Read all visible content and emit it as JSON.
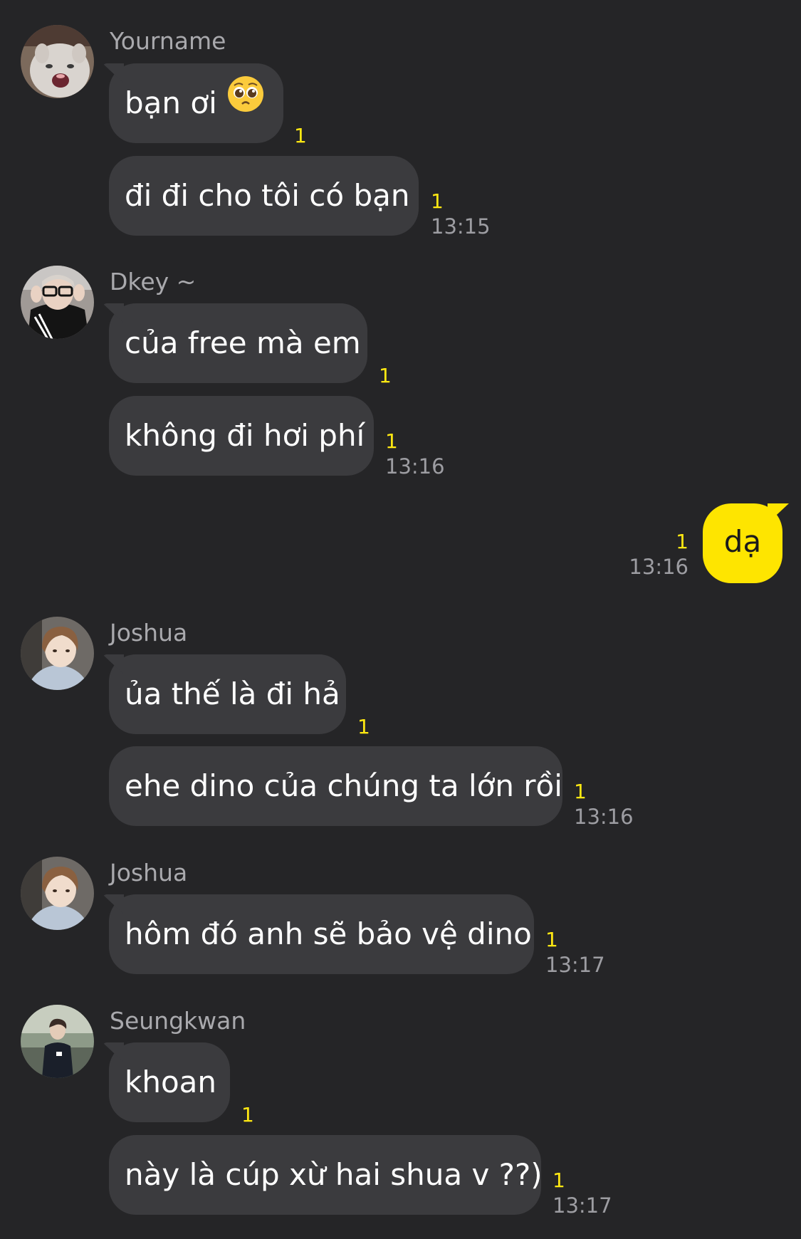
{
  "accent_colors": {
    "my_bubble": "#fee500",
    "unread_count": "#ffe812",
    "other_bubble": "#3b3b3e",
    "background": "#252527"
  },
  "messages": [
    {
      "sender": "Yourname",
      "avatar": "cat-screaming-avatar",
      "bubbles": [
        {
          "text": "bạn ơi",
          "emoji": "pleading-face-icon",
          "unread": "1"
        },
        {
          "text": "đi đi cho tôi có bạn",
          "unread": "1",
          "time": "13:15"
        }
      ]
    },
    {
      "sender": "Dkey ~",
      "avatar": "person-with-glasses-avatar",
      "bubbles": [
        {
          "text": "của free mà em",
          "unread": "1"
        },
        {
          "text": "không đi hơi phí",
          "unread": "1",
          "time": "13:16"
        }
      ]
    },
    {
      "sender": "",
      "mine": true,
      "bubbles": [
        {
          "text": "dạ",
          "unread": "1",
          "time": "13:16"
        }
      ]
    },
    {
      "sender": "Joshua",
      "avatar": "joshua-avatar",
      "bubbles": [
        {
          "text": "ủa thế là đi hả",
          "unread": "1"
        },
        {
          "text": "ehe dino của chúng ta lớn rồi",
          "unread": "1",
          "time": "13:16"
        }
      ]
    },
    {
      "sender": "Joshua",
      "avatar": "joshua-avatar",
      "bubbles": [
        {
          "text": "hôm đó anh sẽ bảo vệ dino",
          "unread": "1",
          "time": "13:17"
        }
      ]
    },
    {
      "sender": "Seungkwan",
      "avatar": "seungkwan-avatar",
      "bubbles": [
        {
          "text": "khoan",
          "unread": "1"
        },
        {
          "text": "này là cúp xừ hai shua v ??)",
          "unread": "1",
          "time": "13:17"
        }
      ]
    }
  ]
}
